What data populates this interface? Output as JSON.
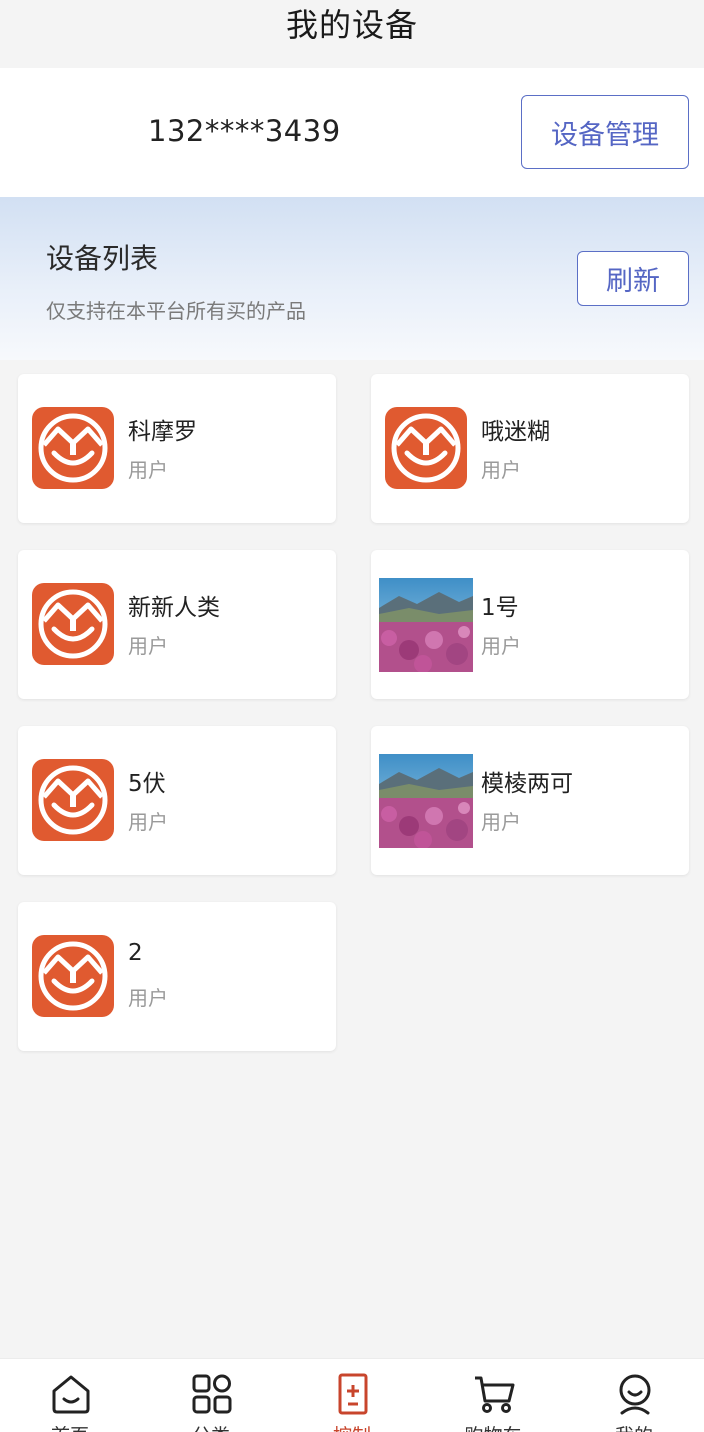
{
  "header": {
    "title": "我的设备"
  },
  "account": {
    "phone": "132****3439",
    "manage_label": "设备管理"
  },
  "device_list": {
    "title": "设备列表",
    "subtitle": "仅支持在本平台所有买的产品",
    "refresh_label": "刷新",
    "devices": [
      {
        "name": "科摩罗",
        "role": "用户",
        "icon": "brand-logo"
      },
      {
        "name": "哦迷糊",
        "role": "用户",
        "icon": "brand-logo"
      },
      {
        "name": "新新人类",
        "role": "用户",
        "icon": "brand-logo"
      },
      {
        "name": "1号",
        "role": "用户",
        "icon": "landscape-photo"
      },
      {
        "name": "5伏",
        "role": "用户",
        "icon": "brand-logo"
      },
      {
        "name": "模棱两可",
        "role": "用户",
        "icon": "landscape-photo"
      },
      {
        "name": "2",
        "role": "用户",
        "icon": "brand-logo"
      }
    ]
  },
  "tabbar": {
    "items": [
      {
        "label": "首页",
        "icon": "home-icon"
      },
      {
        "label": "分类",
        "icon": "category-icon"
      },
      {
        "label": "控制",
        "icon": "control-icon",
        "active": true
      },
      {
        "label": "购物车",
        "icon": "cart-icon"
      },
      {
        "label": "我的",
        "icon": "profile-icon"
      }
    ]
  },
  "colors": {
    "accent": "#5566c4",
    "brand": "#e05a30",
    "active_tab": "#c8452c"
  }
}
